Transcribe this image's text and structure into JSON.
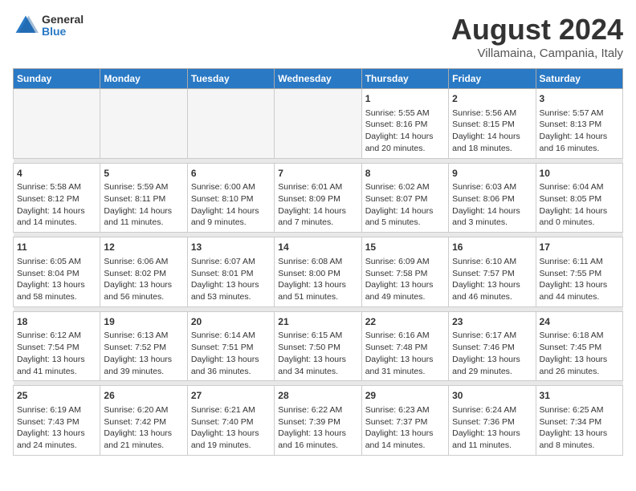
{
  "header": {
    "logo_general": "General",
    "logo_blue": "Blue",
    "month_title": "August 2024",
    "location": "Villamaina, Campania, Italy"
  },
  "weekdays": [
    "Sunday",
    "Monday",
    "Tuesday",
    "Wednesday",
    "Thursday",
    "Friday",
    "Saturday"
  ],
  "weeks": [
    {
      "days": [
        {
          "num": "",
          "info": ""
        },
        {
          "num": "",
          "info": ""
        },
        {
          "num": "",
          "info": ""
        },
        {
          "num": "",
          "info": ""
        },
        {
          "num": "1",
          "info": "Sunrise: 5:55 AM\nSunset: 8:16 PM\nDaylight: 14 hours\nand 20 minutes."
        },
        {
          "num": "2",
          "info": "Sunrise: 5:56 AM\nSunset: 8:15 PM\nDaylight: 14 hours\nand 18 minutes."
        },
        {
          "num": "3",
          "info": "Sunrise: 5:57 AM\nSunset: 8:13 PM\nDaylight: 14 hours\nand 16 minutes."
        }
      ]
    },
    {
      "days": [
        {
          "num": "4",
          "info": "Sunrise: 5:58 AM\nSunset: 8:12 PM\nDaylight: 14 hours\nand 14 minutes."
        },
        {
          "num": "5",
          "info": "Sunrise: 5:59 AM\nSunset: 8:11 PM\nDaylight: 14 hours\nand 11 minutes."
        },
        {
          "num": "6",
          "info": "Sunrise: 6:00 AM\nSunset: 8:10 PM\nDaylight: 14 hours\nand 9 minutes."
        },
        {
          "num": "7",
          "info": "Sunrise: 6:01 AM\nSunset: 8:09 PM\nDaylight: 14 hours\nand 7 minutes."
        },
        {
          "num": "8",
          "info": "Sunrise: 6:02 AM\nSunset: 8:07 PM\nDaylight: 14 hours\nand 5 minutes."
        },
        {
          "num": "9",
          "info": "Sunrise: 6:03 AM\nSunset: 8:06 PM\nDaylight: 14 hours\nand 3 minutes."
        },
        {
          "num": "10",
          "info": "Sunrise: 6:04 AM\nSunset: 8:05 PM\nDaylight: 14 hours\nand 0 minutes."
        }
      ]
    },
    {
      "days": [
        {
          "num": "11",
          "info": "Sunrise: 6:05 AM\nSunset: 8:04 PM\nDaylight: 13 hours\nand 58 minutes."
        },
        {
          "num": "12",
          "info": "Sunrise: 6:06 AM\nSunset: 8:02 PM\nDaylight: 13 hours\nand 56 minutes."
        },
        {
          "num": "13",
          "info": "Sunrise: 6:07 AM\nSunset: 8:01 PM\nDaylight: 13 hours\nand 53 minutes."
        },
        {
          "num": "14",
          "info": "Sunrise: 6:08 AM\nSunset: 8:00 PM\nDaylight: 13 hours\nand 51 minutes."
        },
        {
          "num": "15",
          "info": "Sunrise: 6:09 AM\nSunset: 7:58 PM\nDaylight: 13 hours\nand 49 minutes."
        },
        {
          "num": "16",
          "info": "Sunrise: 6:10 AM\nSunset: 7:57 PM\nDaylight: 13 hours\nand 46 minutes."
        },
        {
          "num": "17",
          "info": "Sunrise: 6:11 AM\nSunset: 7:55 PM\nDaylight: 13 hours\nand 44 minutes."
        }
      ]
    },
    {
      "days": [
        {
          "num": "18",
          "info": "Sunrise: 6:12 AM\nSunset: 7:54 PM\nDaylight: 13 hours\nand 41 minutes."
        },
        {
          "num": "19",
          "info": "Sunrise: 6:13 AM\nSunset: 7:52 PM\nDaylight: 13 hours\nand 39 minutes."
        },
        {
          "num": "20",
          "info": "Sunrise: 6:14 AM\nSunset: 7:51 PM\nDaylight: 13 hours\nand 36 minutes."
        },
        {
          "num": "21",
          "info": "Sunrise: 6:15 AM\nSunset: 7:50 PM\nDaylight: 13 hours\nand 34 minutes."
        },
        {
          "num": "22",
          "info": "Sunrise: 6:16 AM\nSunset: 7:48 PM\nDaylight: 13 hours\nand 31 minutes."
        },
        {
          "num": "23",
          "info": "Sunrise: 6:17 AM\nSunset: 7:46 PM\nDaylight: 13 hours\nand 29 minutes."
        },
        {
          "num": "24",
          "info": "Sunrise: 6:18 AM\nSunset: 7:45 PM\nDaylight: 13 hours\nand 26 minutes."
        }
      ]
    },
    {
      "days": [
        {
          "num": "25",
          "info": "Sunrise: 6:19 AM\nSunset: 7:43 PM\nDaylight: 13 hours\nand 24 minutes."
        },
        {
          "num": "26",
          "info": "Sunrise: 6:20 AM\nSunset: 7:42 PM\nDaylight: 13 hours\nand 21 minutes."
        },
        {
          "num": "27",
          "info": "Sunrise: 6:21 AM\nSunset: 7:40 PM\nDaylight: 13 hours\nand 19 minutes."
        },
        {
          "num": "28",
          "info": "Sunrise: 6:22 AM\nSunset: 7:39 PM\nDaylight: 13 hours\nand 16 minutes."
        },
        {
          "num": "29",
          "info": "Sunrise: 6:23 AM\nSunset: 7:37 PM\nDaylight: 13 hours\nand 14 minutes."
        },
        {
          "num": "30",
          "info": "Sunrise: 6:24 AM\nSunset: 7:36 PM\nDaylight: 13 hours\nand 11 minutes."
        },
        {
          "num": "31",
          "info": "Sunrise: 6:25 AM\nSunset: 7:34 PM\nDaylight: 13 hours\nand 8 minutes."
        }
      ]
    }
  ]
}
